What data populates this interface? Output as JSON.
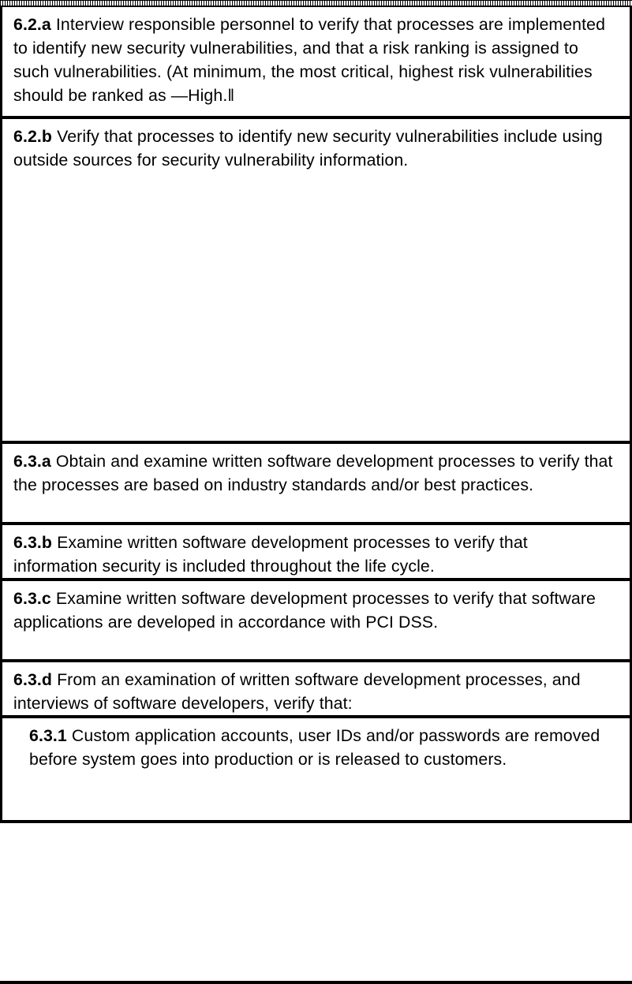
{
  "rows": [
    {
      "number": "6.2.a",
      "text": "Interview responsible personnel to verify that processes are implemented to identify new security vulnerabilities, and that a risk ranking is assigned to such vulnerabilities. (At minimum, the most critical, highest risk vulnerabilities should be ranked as —High.‖"
    },
    {
      "number": "6.2.b",
      "text": "Verify that processes to identify new security vulnerabilities include using outside sources for security vulnerability information."
    },
    {
      "number": "6.3.a",
      "text": "Obtain and examine written software development processes to verify that the processes are based on industry standards and/or best practices."
    },
    {
      "number": "6.3.b",
      "text": "Examine written software development processes to verify that information security is included throughout the life cycle."
    },
    {
      "number": "6.3.c",
      "text": "Examine written software development processes to verify that software applications are developed in accordance with PCI DSS."
    },
    {
      "number": "6.3.d",
      "text": "From an examination of written software development processes, and interviews of software developers, verify that:"
    },
    {
      "number": "6.3.1",
      "text": "Custom application accounts, user IDs and/or passwords are removed before system goes into production or is released to customers."
    }
  ]
}
